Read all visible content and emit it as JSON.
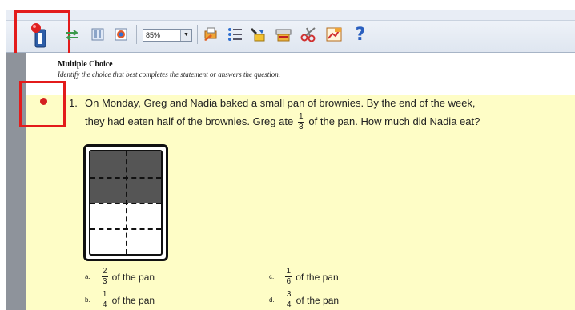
{
  "toolbar": {
    "zoom_value": "85%",
    "icons": [
      "answer-key-icon",
      "arrows-icon",
      "columns-icon",
      "color-icon",
      "print-icon",
      "list-icon",
      "tools-icon",
      "scan-icon",
      "scissors-icon",
      "chart-icon",
      "help-icon"
    ],
    "help_label": "?"
  },
  "document": {
    "section_title": "Multiple Choice",
    "section_instructions": "Identify the choice that best completes the statement or answers the question.",
    "question": {
      "number": "1.",
      "line1": "On Monday, Greg and Nadia baked a small pan of brownies. By the end of the week,",
      "line2_before": "they had eaten half of the brownies. Greg ate",
      "line2_frac_num": "1",
      "line2_frac_den": "3",
      "line2_after": "of the pan. How much did Nadia eat?",
      "figure_shaded_fraction": 0.5
    },
    "choices": [
      {
        "letter": "a.",
        "num": "2",
        "den": "3",
        "text": "of the pan"
      },
      {
        "letter": "c.",
        "num": "1",
        "den": "6",
        "text": "of the pan"
      },
      {
        "letter": "b.",
        "num": "1",
        "den": "4",
        "text": "of the pan"
      },
      {
        "letter": "d.",
        "num": "3",
        "den": "4",
        "text": "of the pan"
      }
    ]
  },
  "colors": {
    "highlight": "#e31b1b",
    "question_background": "#fefdc6",
    "bookmark_dot": "#d42020"
  }
}
